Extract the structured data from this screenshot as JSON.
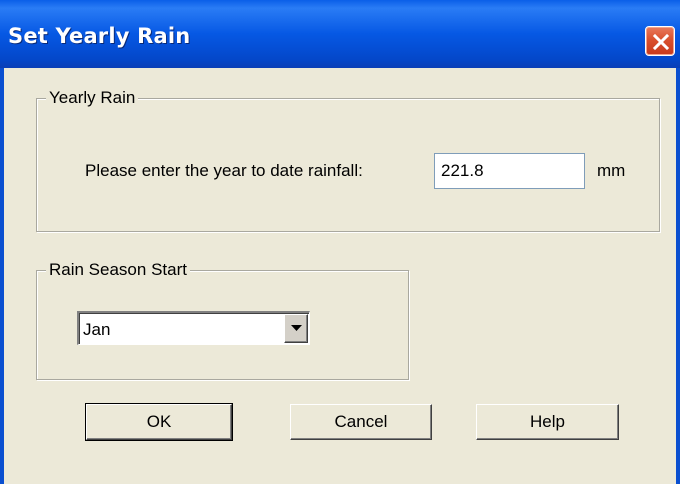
{
  "window": {
    "title": "Set Yearly Rain"
  },
  "yearly_rain": {
    "group_label": "Yearly Rain",
    "prompt": "Please enter the year to date rainfall:",
    "value": "221.8",
    "unit": "mm"
  },
  "rain_season": {
    "group_label": "Rain Season Start",
    "selected": "Jan"
  },
  "buttons": {
    "ok": "OK",
    "cancel": "Cancel",
    "help": "Help"
  },
  "icons": {
    "close": "close-icon",
    "dropdown": "chevron-down-icon"
  },
  "colors": {
    "titlebar": "#0658e4",
    "close_button": "#d9502d",
    "dialog_background": "#ece9d8"
  }
}
